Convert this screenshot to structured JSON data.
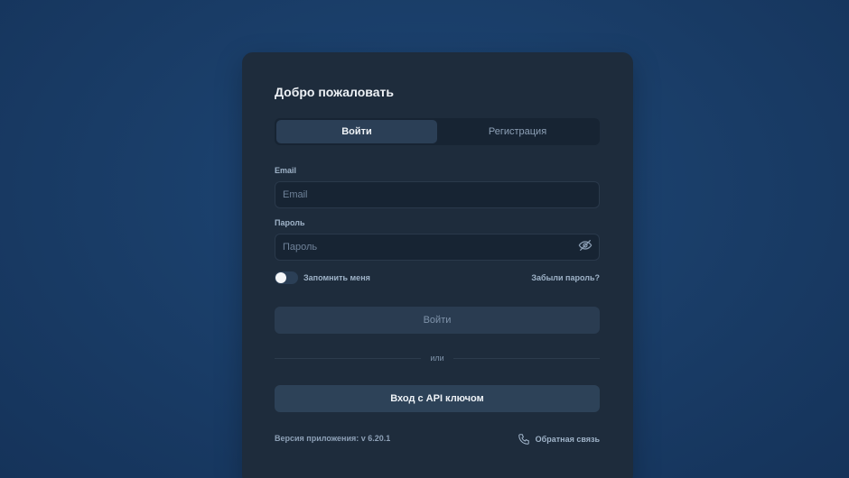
{
  "card": {
    "title": "Добро пожаловать",
    "tabs": [
      {
        "label": "Войти",
        "active": true
      },
      {
        "label": "Регистрация",
        "active": false
      }
    ],
    "email": {
      "label": "Email",
      "placeholder": "Email",
      "value": ""
    },
    "password": {
      "label": "Пароль",
      "placeholder": "Пароль",
      "value": "",
      "visibility_icon": "eye-off-icon"
    },
    "remember": {
      "label": "Запомнить меня",
      "checked": false
    },
    "forgot_label": "Забыли пароль?",
    "login_button": "Войти",
    "divider_text": "или",
    "api_button": "Вход с API ключом",
    "version_text": "Версия приложения: v 6.20.1",
    "feedback": {
      "label": "Обратная связь",
      "icon": "phone-icon"
    }
  },
  "colors": {
    "background": "#1a3e69",
    "card": "#1e2c3c",
    "input": "#172433",
    "active_tab": "#2b3f56",
    "button": "#2d4258",
    "muted_text": "#9fb3c8"
  }
}
